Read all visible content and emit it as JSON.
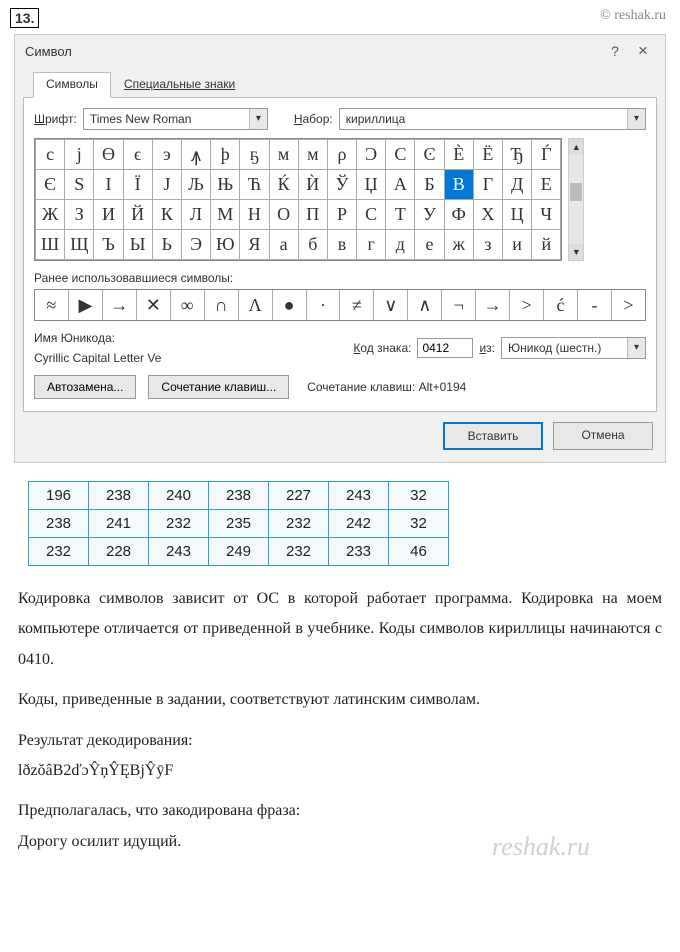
{
  "task_number": "13.",
  "watermark": "© reshak.ru",
  "watermark2": "reshak.ru",
  "dialog": {
    "title": "Символ",
    "help": "?",
    "close": "×",
    "tabs": [
      "Символы",
      "Специальные знаки"
    ],
    "font_label_pre": "Ш",
    "font_label_rest": "рифт:",
    "font_value": "Times New Roman",
    "set_label_pre": "Н",
    "set_label_rest": "абор:",
    "set_value": "кириллица",
    "grid": [
      [
        "с",
        "ј",
        "ϴ",
        "ϵ",
        "э",
        "ꙟ",
        "þ",
        "ҕ",
        "м",
        "м",
        "ρ",
        "Ͻ",
        "Ϲ",
        "Ͼ",
        "Ѐ",
        "Ё",
        "Ђ",
        "Ѓ"
      ],
      [
        "Є",
        "Ѕ",
        "І",
        "Ї",
        "Ј",
        "Љ",
        "Њ",
        "Ћ",
        "Ќ",
        "Ѝ",
        "Ў",
        "Џ",
        "А",
        "Б",
        "В",
        "Г",
        "Д",
        "Е"
      ],
      [
        "Ж",
        "З",
        "И",
        "Й",
        "К",
        "Л",
        "М",
        "Н",
        "О",
        "П",
        "Р",
        "С",
        "Т",
        "У",
        "Ф",
        "Х",
        "Ц",
        "Ч"
      ],
      [
        "Ш",
        "Щ",
        "Ъ",
        "Ы",
        "Ь",
        "Э",
        "Ю",
        "Я",
        "а",
        "б",
        "в",
        "г",
        "д",
        "е",
        "ж",
        "з",
        "и",
        "й"
      ]
    ],
    "selected_row": 1,
    "selected_col": 14,
    "recent_label": "Ранее использовавшиеся символы:",
    "recent": [
      "≈",
      "▶",
      "→",
      "✕",
      "∞",
      "∩",
      "Λ",
      "●",
      "·",
      "≠",
      "∨",
      "∧",
      "¬",
      "→",
      ">",
      "ć",
      "-",
      ">"
    ],
    "unicode_label": "Имя Юникода:",
    "unicode_value": "Cyrillic Capital Letter Ve",
    "code_label_pre": "К",
    "code_label_rest": "од знака:",
    "code_value": "0412",
    "from_label_pre": "и",
    "from_label_rest": "з:",
    "from_value": "Юникод (шестн.)",
    "autocorrect": "Автозамена...",
    "shortcut": "Сочетание клавиш...",
    "shortcut_label": "Сочетание клавиш: Alt+0194",
    "insert": "Вставить",
    "cancel": "Отмена"
  },
  "code_table": [
    [
      "196",
      "238",
      "240",
      "238",
      "227",
      "243",
      "32"
    ],
    [
      "238",
      "241",
      "232",
      "235",
      "232",
      "242",
      "32"
    ],
    [
      "232",
      "228",
      "243",
      "249",
      "232",
      "233",
      "46"
    ]
  ],
  "para1": "Кодировка символов зависит от ОС в которой работает программа. Кодировка на моем компьютере отличается от приведенной в учебнике. Коды символов кириллицы начинаются с 0410.",
  "para2": "Коды, приведенные в задании, соответствуют латинским символам.",
  "para3a": "Результат декодирования:",
  "para3b": "lðzǒâВ2ďɔŶņŶĘВјŶӯF",
  "para4a": "Предполагалась, что закодирована фраза:",
  "para4b": "Дорогу осилит идущий."
}
